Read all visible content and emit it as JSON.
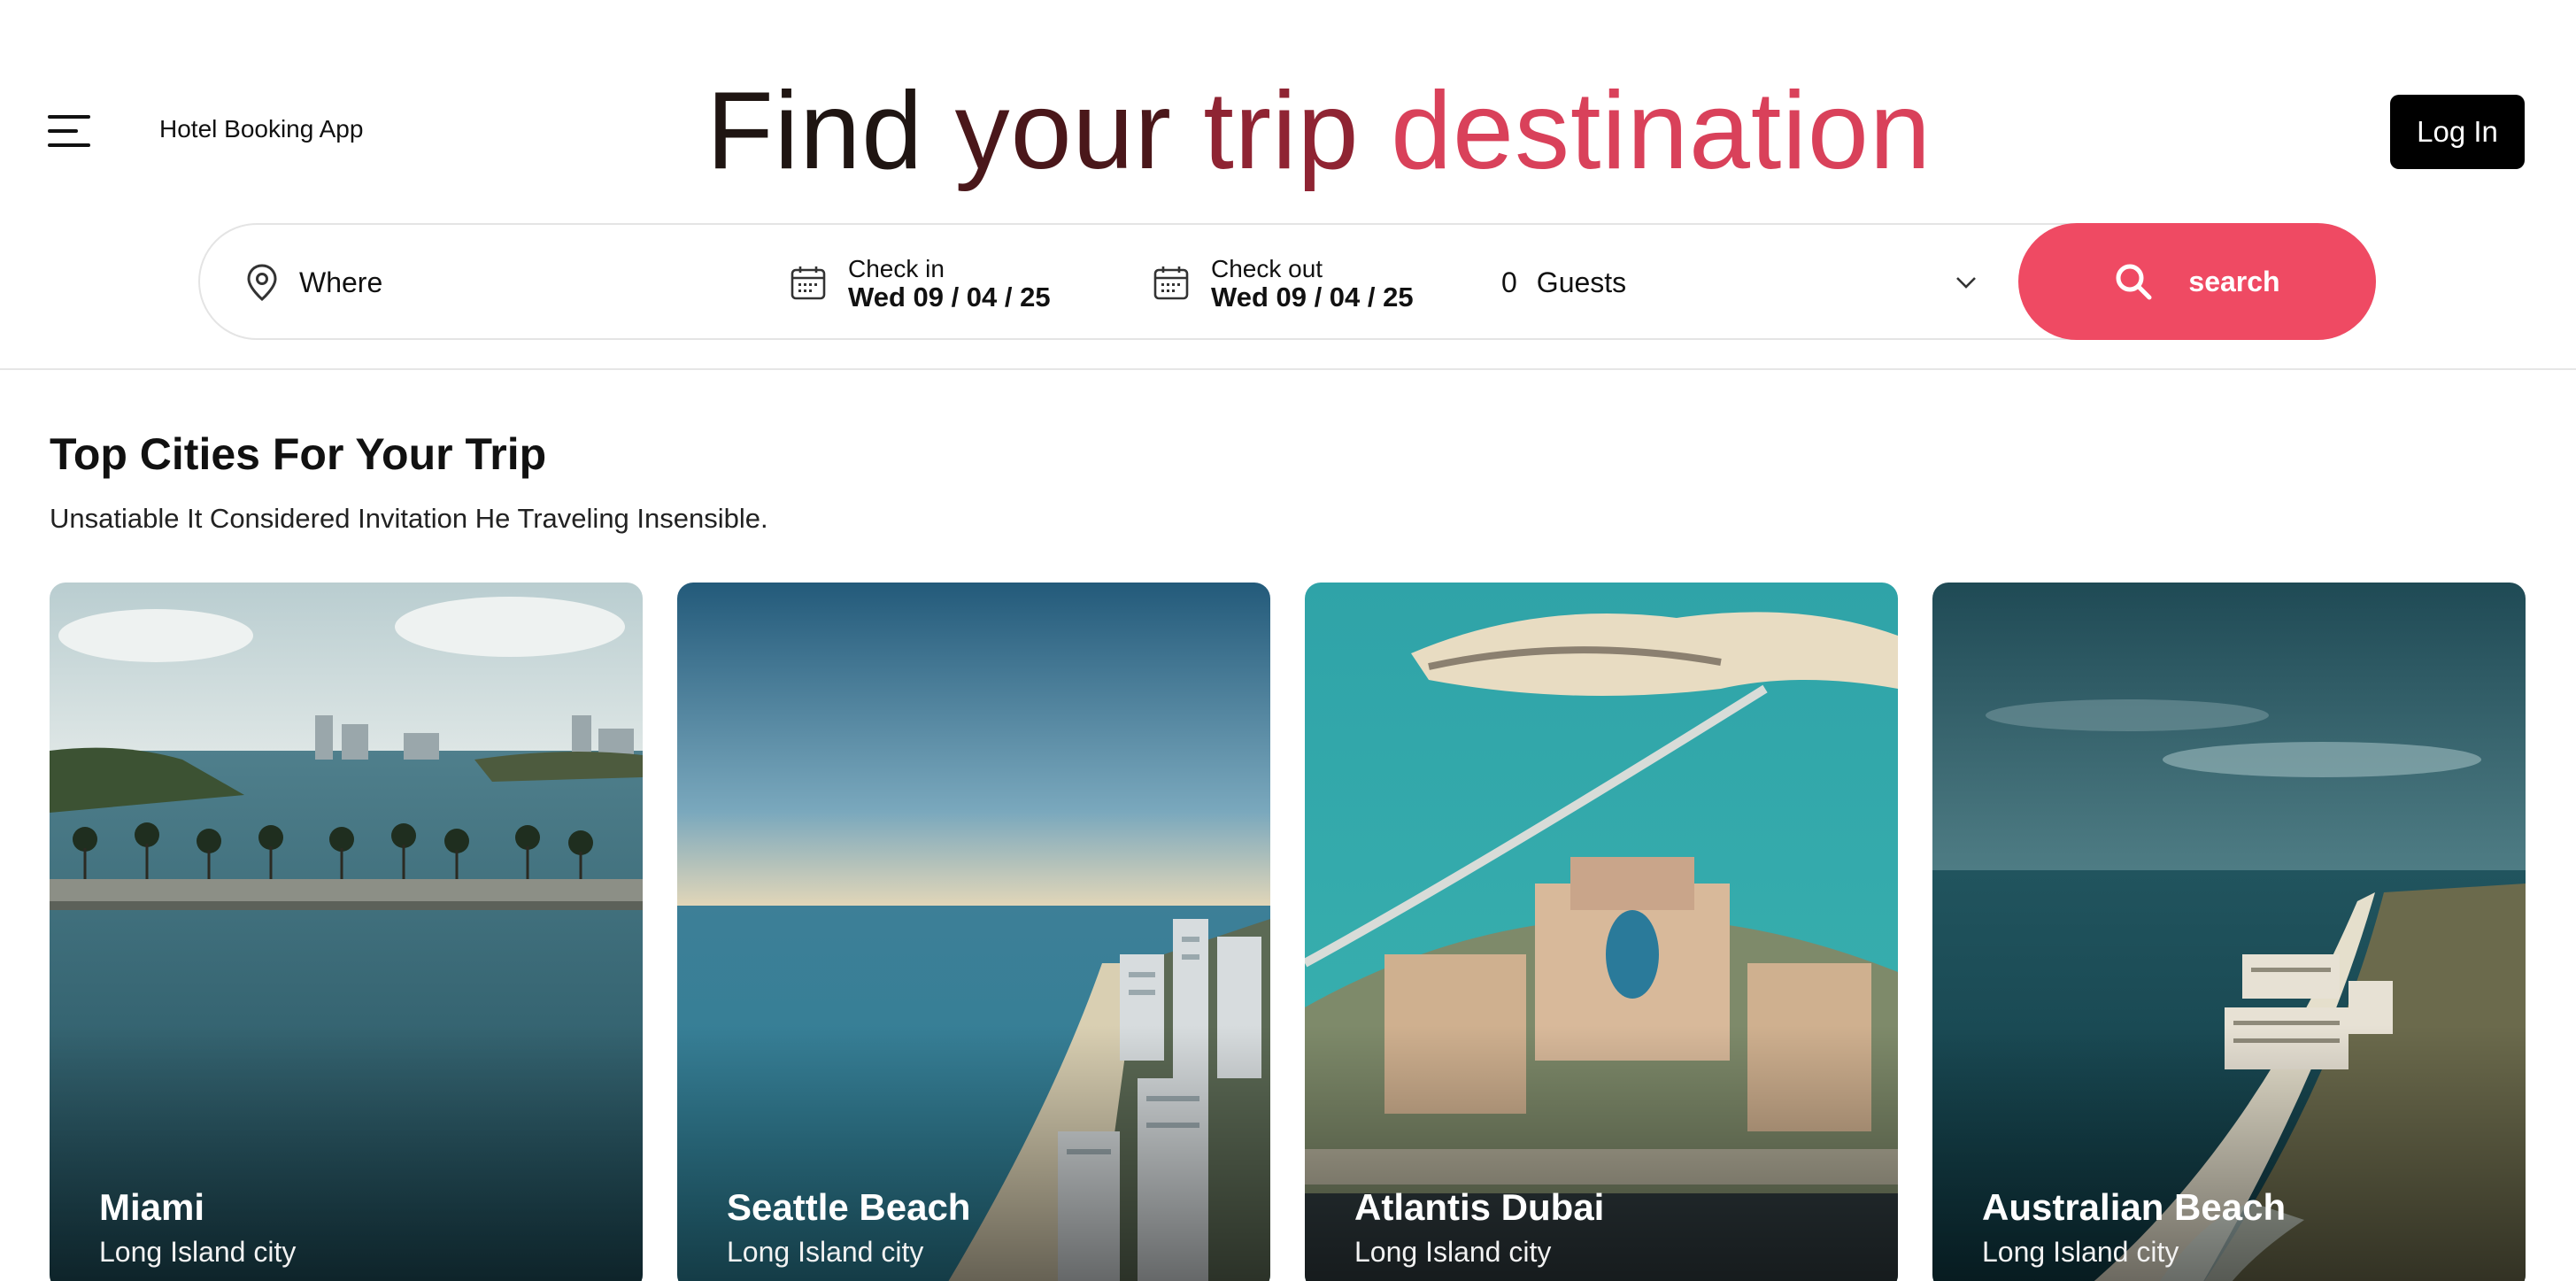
{
  "header": {
    "app_name": "Hotel Booking App",
    "hero_words": [
      "Find",
      "your",
      "trip",
      "destination"
    ],
    "login_label": "Log In"
  },
  "search": {
    "where_label": "Where",
    "check_in_label": "Check in",
    "check_in_value": "Wed 09 / 04 / 25",
    "check_out_label": "Check out",
    "check_out_value": "Wed 09 / 04 / 25",
    "guests_count": "0",
    "guests_label": "Guests",
    "button_label": "search"
  },
  "section": {
    "title": "Top Cities For Your Trip",
    "subtitle": "Unsatiable It Considered Invitation He Traveling Insensible."
  },
  "cities": [
    {
      "name": "Miami",
      "subtitle": "Long Island city"
    },
    {
      "name": "Seattle Beach",
      "subtitle": "Long Island city"
    },
    {
      "name": "Atlantis Dubai",
      "subtitle": "Long Island city"
    },
    {
      "name": "Australian Beach",
      "subtitle": "Long Island city"
    }
  ],
  "colors": {
    "accent": "#ef4a63",
    "login_bg": "#000000"
  },
  "icons": [
    "menu-icon",
    "location-pin-icon",
    "calendar-icon",
    "chevron-down-icon",
    "search-icon"
  ]
}
